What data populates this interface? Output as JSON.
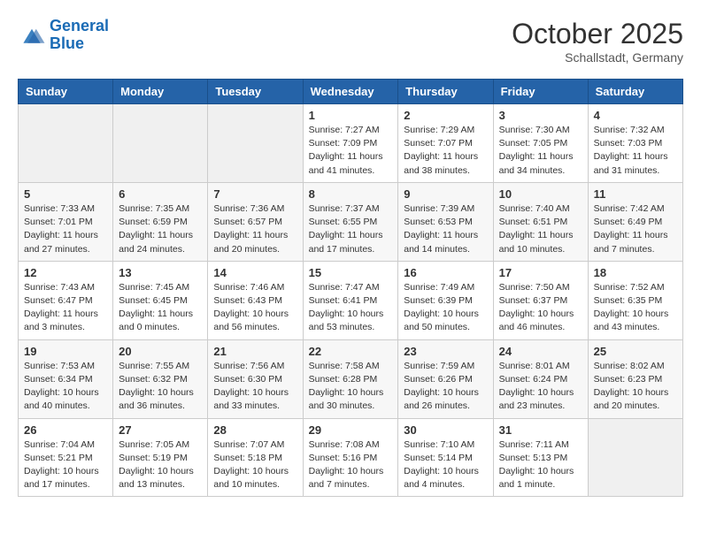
{
  "header": {
    "logo_line1": "General",
    "logo_line2": "Blue",
    "month": "October 2025",
    "location": "Schallstadt, Germany"
  },
  "days_of_week": [
    "Sunday",
    "Monday",
    "Tuesday",
    "Wednesday",
    "Thursday",
    "Friday",
    "Saturday"
  ],
  "weeks": [
    [
      {
        "day": "",
        "sunrise": "",
        "sunset": "",
        "daylight": ""
      },
      {
        "day": "",
        "sunrise": "",
        "sunset": "",
        "daylight": ""
      },
      {
        "day": "",
        "sunrise": "",
        "sunset": "",
        "daylight": ""
      },
      {
        "day": "1",
        "sunrise": "Sunrise: 7:27 AM",
        "sunset": "Sunset: 7:09 PM",
        "daylight": "Daylight: 11 hours and 41 minutes."
      },
      {
        "day": "2",
        "sunrise": "Sunrise: 7:29 AM",
        "sunset": "Sunset: 7:07 PM",
        "daylight": "Daylight: 11 hours and 38 minutes."
      },
      {
        "day": "3",
        "sunrise": "Sunrise: 7:30 AM",
        "sunset": "Sunset: 7:05 PM",
        "daylight": "Daylight: 11 hours and 34 minutes."
      },
      {
        "day": "4",
        "sunrise": "Sunrise: 7:32 AM",
        "sunset": "Sunset: 7:03 PM",
        "daylight": "Daylight: 11 hours and 31 minutes."
      }
    ],
    [
      {
        "day": "5",
        "sunrise": "Sunrise: 7:33 AM",
        "sunset": "Sunset: 7:01 PM",
        "daylight": "Daylight: 11 hours and 27 minutes."
      },
      {
        "day": "6",
        "sunrise": "Sunrise: 7:35 AM",
        "sunset": "Sunset: 6:59 PM",
        "daylight": "Daylight: 11 hours and 24 minutes."
      },
      {
        "day": "7",
        "sunrise": "Sunrise: 7:36 AM",
        "sunset": "Sunset: 6:57 PM",
        "daylight": "Daylight: 11 hours and 20 minutes."
      },
      {
        "day": "8",
        "sunrise": "Sunrise: 7:37 AM",
        "sunset": "Sunset: 6:55 PM",
        "daylight": "Daylight: 11 hours and 17 minutes."
      },
      {
        "day": "9",
        "sunrise": "Sunrise: 7:39 AM",
        "sunset": "Sunset: 6:53 PM",
        "daylight": "Daylight: 11 hours and 14 minutes."
      },
      {
        "day": "10",
        "sunrise": "Sunrise: 7:40 AM",
        "sunset": "Sunset: 6:51 PM",
        "daylight": "Daylight: 11 hours and 10 minutes."
      },
      {
        "day": "11",
        "sunrise": "Sunrise: 7:42 AM",
        "sunset": "Sunset: 6:49 PM",
        "daylight": "Daylight: 11 hours and 7 minutes."
      }
    ],
    [
      {
        "day": "12",
        "sunrise": "Sunrise: 7:43 AM",
        "sunset": "Sunset: 6:47 PM",
        "daylight": "Daylight: 11 hours and 3 minutes."
      },
      {
        "day": "13",
        "sunrise": "Sunrise: 7:45 AM",
        "sunset": "Sunset: 6:45 PM",
        "daylight": "Daylight: 11 hours and 0 minutes."
      },
      {
        "day": "14",
        "sunrise": "Sunrise: 7:46 AM",
        "sunset": "Sunset: 6:43 PM",
        "daylight": "Daylight: 10 hours and 56 minutes."
      },
      {
        "day": "15",
        "sunrise": "Sunrise: 7:47 AM",
        "sunset": "Sunset: 6:41 PM",
        "daylight": "Daylight: 10 hours and 53 minutes."
      },
      {
        "day": "16",
        "sunrise": "Sunrise: 7:49 AM",
        "sunset": "Sunset: 6:39 PM",
        "daylight": "Daylight: 10 hours and 50 minutes."
      },
      {
        "day": "17",
        "sunrise": "Sunrise: 7:50 AM",
        "sunset": "Sunset: 6:37 PM",
        "daylight": "Daylight: 10 hours and 46 minutes."
      },
      {
        "day": "18",
        "sunrise": "Sunrise: 7:52 AM",
        "sunset": "Sunset: 6:35 PM",
        "daylight": "Daylight: 10 hours and 43 minutes."
      }
    ],
    [
      {
        "day": "19",
        "sunrise": "Sunrise: 7:53 AM",
        "sunset": "Sunset: 6:34 PM",
        "daylight": "Daylight: 10 hours and 40 minutes."
      },
      {
        "day": "20",
        "sunrise": "Sunrise: 7:55 AM",
        "sunset": "Sunset: 6:32 PM",
        "daylight": "Daylight: 10 hours and 36 minutes."
      },
      {
        "day": "21",
        "sunrise": "Sunrise: 7:56 AM",
        "sunset": "Sunset: 6:30 PM",
        "daylight": "Daylight: 10 hours and 33 minutes."
      },
      {
        "day": "22",
        "sunrise": "Sunrise: 7:58 AM",
        "sunset": "Sunset: 6:28 PM",
        "daylight": "Daylight: 10 hours and 30 minutes."
      },
      {
        "day": "23",
        "sunrise": "Sunrise: 7:59 AM",
        "sunset": "Sunset: 6:26 PM",
        "daylight": "Daylight: 10 hours and 26 minutes."
      },
      {
        "day": "24",
        "sunrise": "Sunrise: 8:01 AM",
        "sunset": "Sunset: 6:24 PM",
        "daylight": "Daylight: 10 hours and 23 minutes."
      },
      {
        "day": "25",
        "sunrise": "Sunrise: 8:02 AM",
        "sunset": "Sunset: 6:23 PM",
        "daylight": "Daylight: 10 hours and 20 minutes."
      }
    ],
    [
      {
        "day": "26",
        "sunrise": "Sunrise: 7:04 AM",
        "sunset": "Sunset: 5:21 PM",
        "daylight": "Daylight: 10 hours and 17 minutes."
      },
      {
        "day": "27",
        "sunrise": "Sunrise: 7:05 AM",
        "sunset": "Sunset: 5:19 PM",
        "daylight": "Daylight: 10 hours and 13 minutes."
      },
      {
        "day": "28",
        "sunrise": "Sunrise: 7:07 AM",
        "sunset": "Sunset: 5:18 PM",
        "daylight": "Daylight: 10 hours and 10 minutes."
      },
      {
        "day": "29",
        "sunrise": "Sunrise: 7:08 AM",
        "sunset": "Sunset: 5:16 PM",
        "daylight": "Daylight: 10 hours and 7 minutes."
      },
      {
        "day": "30",
        "sunrise": "Sunrise: 7:10 AM",
        "sunset": "Sunset: 5:14 PM",
        "daylight": "Daylight: 10 hours and 4 minutes."
      },
      {
        "day": "31",
        "sunrise": "Sunrise: 7:11 AM",
        "sunset": "Sunset: 5:13 PM",
        "daylight": "Daylight: 10 hours and 1 minute."
      },
      {
        "day": "",
        "sunrise": "",
        "sunset": "",
        "daylight": ""
      }
    ]
  ]
}
